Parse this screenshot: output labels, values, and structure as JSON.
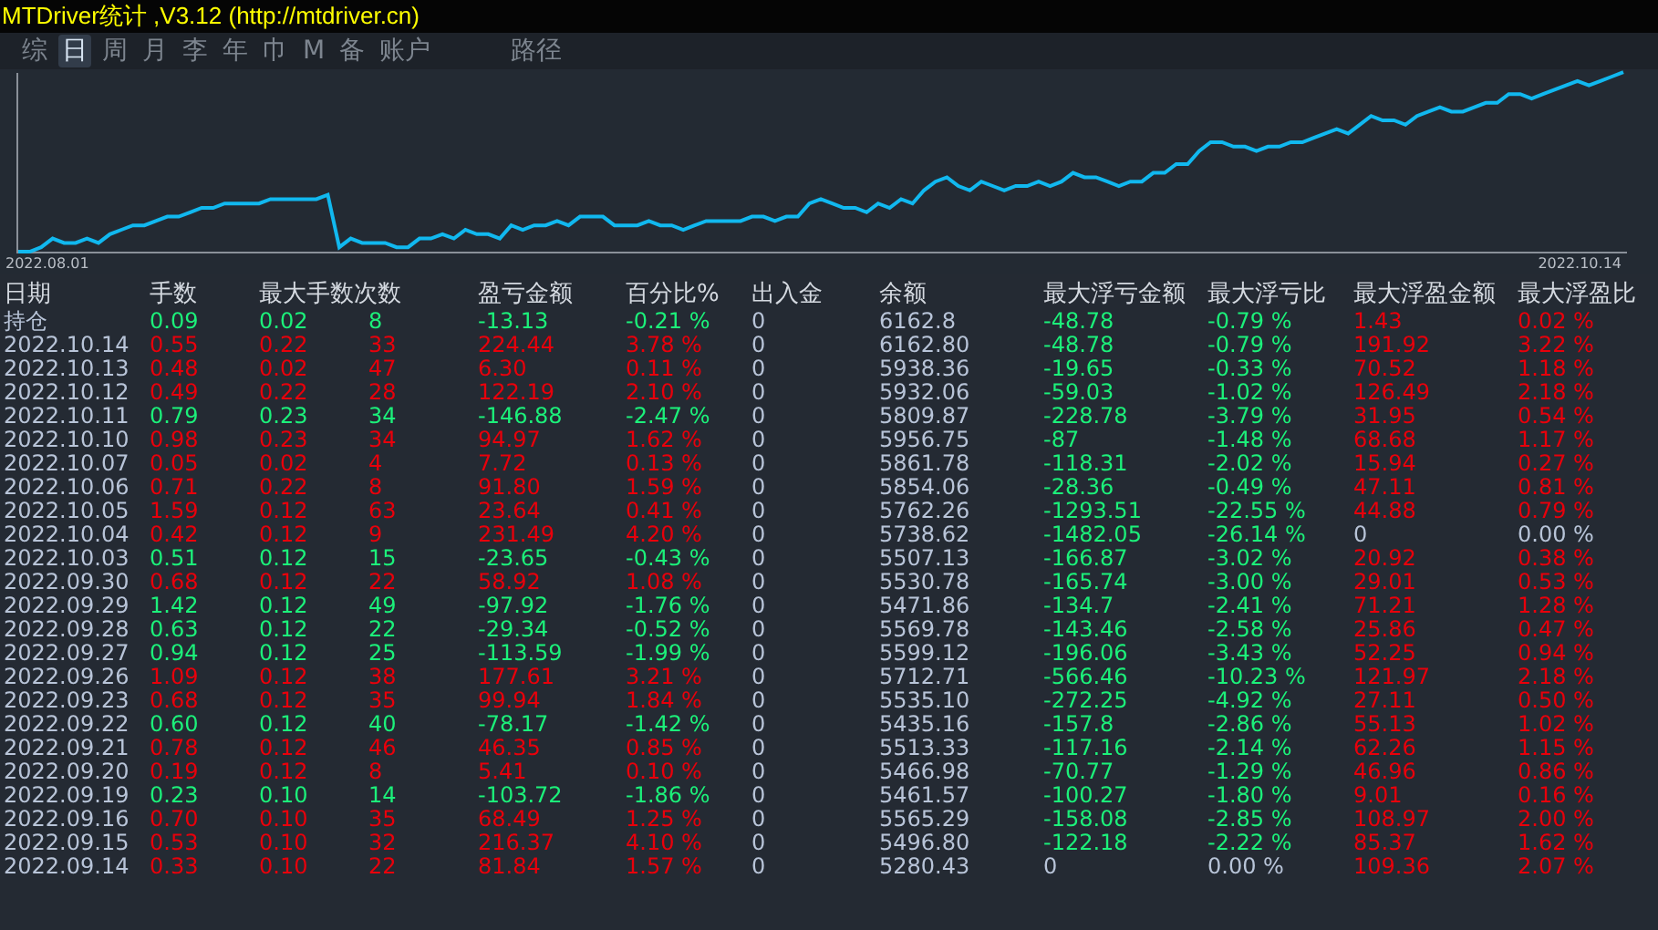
{
  "window": {
    "title": "MTDriver统计 ,V3.12 (http://mtdriver.cn)"
  },
  "tabs": [
    {
      "label": "综",
      "selected": false
    },
    {
      "label": "日",
      "selected": true
    },
    {
      "label": "周",
      "selected": false
    },
    {
      "label": "月",
      "selected": false
    },
    {
      "label": "李",
      "selected": false
    },
    {
      "label": "年",
      "selected": false
    },
    {
      "label": "巾",
      "selected": false
    },
    {
      "label": "M",
      "selected": false
    },
    {
      "label": "备",
      "selected": false
    },
    {
      "label": "账户",
      "selected": false
    },
    {
      "label": "路径",
      "selected": false
    }
  ],
  "chart": {
    "x_start": "2022.08.01",
    "x_end": "2022.10.14"
  },
  "table": {
    "columns": [
      "日期",
      "手数",
      "最大手数次数",
      "",
      "盈亏金额",
      "百分比%",
      "出入金",
      "余额",
      "最大浮亏金额",
      "最大浮亏比",
      "最大浮盈金额",
      "最大浮盈比"
    ],
    "rows": [
      {
        "cells": [
          "持仓",
          "0.09",
          "0.02",
          "8",
          "-13.13",
          "-0.21 %",
          "0",
          "6162.8",
          "-48.78",
          "-0.79 %",
          "1.43",
          "0.02 %"
        ],
        "profit": false,
        "max_loss_zero": false,
        "max_gain_zero": false
      },
      {
        "cells": [
          "2022.10.14",
          "0.55",
          "0.22",
          "33",
          "224.44",
          "3.78 %",
          "0",
          "6162.80",
          "-48.78",
          "-0.79 %",
          "191.92",
          "3.22 %"
        ],
        "profit": true,
        "max_loss_zero": false,
        "max_gain_zero": false
      },
      {
        "cells": [
          "2022.10.13",
          "0.48",
          "0.02",
          "47",
          "6.30",
          "0.11 %",
          "0",
          "5938.36",
          "-19.65",
          "-0.33 %",
          "70.52",
          "1.18 %"
        ],
        "profit": true,
        "max_loss_zero": false,
        "max_gain_zero": false
      },
      {
        "cells": [
          "2022.10.12",
          "0.49",
          "0.22",
          "28",
          "122.19",
          "2.10 %",
          "0",
          "5932.06",
          "-59.03",
          "-1.02 %",
          "126.49",
          "2.18 %"
        ],
        "profit": true,
        "max_loss_zero": false,
        "max_gain_zero": false
      },
      {
        "cells": [
          "2022.10.11",
          "0.79",
          "0.23",
          "34",
          "-146.88",
          "-2.47 %",
          "0",
          "5809.87",
          "-228.78",
          "-3.79 %",
          "31.95",
          "0.54 %"
        ],
        "profit": false,
        "max_loss_zero": false,
        "max_gain_zero": false
      },
      {
        "cells": [
          "2022.10.10",
          "0.98",
          "0.23",
          "34",
          "94.97",
          "1.62 %",
          "0",
          "5956.75",
          "-87",
          "-1.48 %",
          "68.68",
          "1.17 %"
        ],
        "profit": true,
        "max_loss_zero": false,
        "max_gain_zero": false
      },
      {
        "cells": [
          "2022.10.07",
          "0.05",
          "0.02",
          "4",
          "7.72",
          "0.13 %",
          "0",
          "5861.78",
          "-118.31",
          "-2.02 %",
          "15.94",
          "0.27 %"
        ],
        "profit": true,
        "max_loss_zero": false,
        "max_gain_zero": false
      },
      {
        "cells": [
          "2022.10.06",
          "0.71",
          "0.22",
          "8",
          "91.80",
          "1.59 %",
          "0",
          "5854.06",
          "-28.36",
          "-0.49 %",
          "47.11",
          "0.81 %"
        ],
        "profit": true,
        "max_loss_zero": false,
        "max_gain_zero": false
      },
      {
        "cells": [
          "2022.10.05",
          "1.59",
          "0.12",
          "63",
          "23.64",
          "0.41 %",
          "0",
          "5762.26",
          "-1293.51",
          "-22.55 %",
          "44.88",
          "0.79 %"
        ],
        "profit": true,
        "max_loss_zero": false,
        "max_gain_zero": false
      },
      {
        "cells": [
          "2022.10.04",
          "0.42",
          "0.12",
          "9",
          "231.49",
          "4.20 %",
          "0",
          "5738.62",
          "-1482.05",
          "-26.14 %",
          "0",
          "0.00 %"
        ],
        "profit": true,
        "max_loss_zero": false,
        "max_gain_zero": true
      },
      {
        "cells": [
          "2022.10.03",
          "0.51",
          "0.12",
          "15",
          "-23.65",
          "-0.43 %",
          "0",
          "5507.13",
          "-166.87",
          "-3.02 %",
          "20.92",
          "0.38 %"
        ],
        "profit": false,
        "max_loss_zero": false,
        "max_gain_zero": false
      },
      {
        "cells": [
          "2022.09.30",
          "0.68",
          "0.12",
          "22",
          "58.92",
          "1.08 %",
          "0",
          "5530.78",
          "-165.74",
          "-3.00 %",
          "29.01",
          "0.53 %"
        ],
        "profit": true,
        "max_loss_zero": false,
        "max_gain_zero": false
      },
      {
        "cells": [
          "2022.09.29",
          "1.42",
          "0.12",
          "49",
          "-97.92",
          "-1.76 %",
          "0",
          "5471.86",
          "-134.7",
          "-2.41 %",
          "71.21",
          "1.28 %"
        ],
        "profit": false,
        "max_loss_zero": false,
        "max_gain_zero": false
      },
      {
        "cells": [
          "2022.09.28",
          "0.63",
          "0.12",
          "22",
          "-29.34",
          "-0.52 %",
          "0",
          "5569.78",
          "-143.46",
          "-2.58 %",
          "25.86",
          "0.47 %"
        ],
        "profit": false,
        "max_loss_zero": false,
        "max_gain_zero": false
      },
      {
        "cells": [
          "2022.09.27",
          "0.94",
          "0.12",
          "25",
          "-113.59",
          "-1.99 %",
          "0",
          "5599.12",
          "-196.06",
          "-3.43 %",
          "52.25",
          "0.94 %"
        ],
        "profit": false,
        "max_loss_zero": false,
        "max_gain_zero": false
      },
      {
        "cells": [
          "2022.09.26",
          "1.09",
          "0.12",
          "38",
          "177.61",
          "3.21 %",
          "0",
          "5712.71",
          "-566.46",
          "-10.23 %",
          "121.97",
          "2.18 %"
        ],
        "profit": true,
        "max_loss_zero": false,
        "max_gain_zero": false
      },
      {
        "cells": [
          "2022.09.23",
          "0.68",
          "0.12",
          "35",
          "99.94",
          "1.84 %",
          "0",
          "5535.10",
          "-272.25",
          "-4.92 %",
          "27.11",
          "0.50 %"
        ],
        "profit": true,
        "max_loss_zero": false,
        "max_gain_zero": false
      },
      {
        "cells": [
          "2022.09.22",
          "0.60",
          "0.12",
          "40",
          "-78.17",
          "-1.42 %",
          "0",
          "5435.16",
          "-157.8",
          "-2.86 %",
          "55.13",
          "1.02 %"
        ],
        "profit": false,
        "max_loss_zero": false,
        "max_gain_zero": false
      },
      {
        "cells": [
          "2022.09.21",
          "0.78",
          "0.12",
          "46",
          "46.35",
          "0.85 %",
          "0",
          "5513.33",
          "-117.16",
          "-2.14 %",
          "62.26",
          "1.15 %"
        ],
        "profit": true,
        "max_loss_zero": false,
        "max_gain_zero": false
      },
      {
        "cells": [
          "2022.09.20",
          "0.19",
          "0.12",
          "8",
          "5.41",
          "0.10 %",
          "0",
          "5466.98",
          "-70.77",
          "-1.29 %",
          "46.96",
          "0.86 %"
        ],
        "profit": true,
        "max_loss_zero": false,
        "max_gain_zero": false
      },
      {
        "cells": [
          "2022.09.19",
          "0.23",
          "0.10",
          "14",
          "-103.72",
          "-1.86 %",
          "0",
          "5461.57",
          "-100.27",
          "-1.80 %",
          "9.01",
          "0.16 %"
        ],
        "profit": false,
        "max_loss_zero": false,
        "max_gain_zero": false
      },
      {
        "cells": [
          "2022.09.16",
          "0.70",
          "0.10",
          "35",
          "68.49",
          "1.25 %",
          "0",
          "5565.29",
          "-158.08",
          "-2.85 %",
          "108.97",
          "2.00 %"
        ],
        "profit": true,
        "max_loss_zero": false,
        "max_gain_zero": false
      },
      {
        "cells": [
          "2022.09.15",
          "0.53",
          "0.10",
          "32",
          "216.37",
          "4.10 %",
          "0",
          "5496.80",
          "-122.18",
          "-2.22 %",
          "85.37",
          "1.62 %"
        ],
        "profit": true,
        "max_loss_zero": false,
        "max_gain_zero": false
      },
      {
        "cells": [
          "2022.09.14",
          "0.33",
          "0.10",
          "22",
          "81.84",
          "1.57 %",
          "0",
          "5280.43",
          "0",
          "0.00 %",
          "109.36",
          "2.07 %"
        ],
        "profit": true,
        "max_loss_zero": true,
        "max_gain_zero": false
      }
    ]
  }
}
